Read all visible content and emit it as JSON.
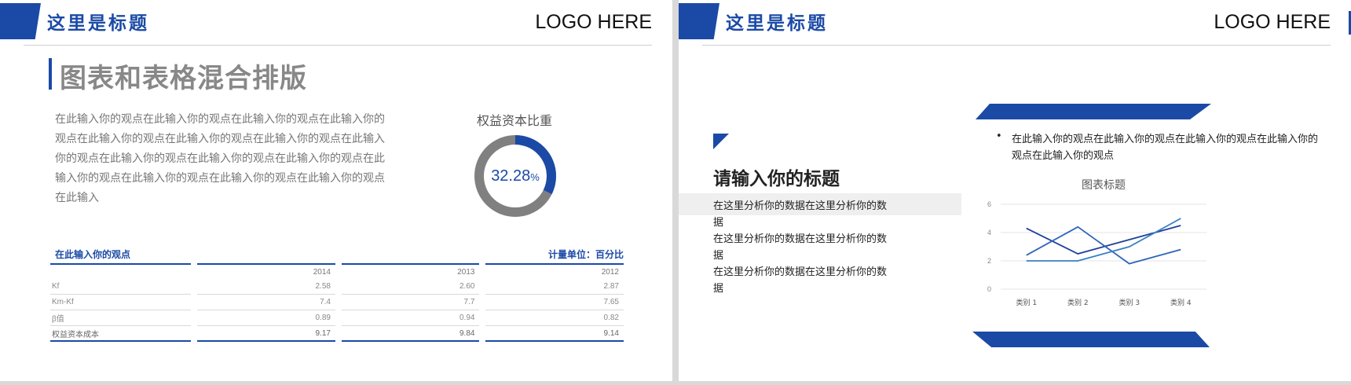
{
  "left": {
    "header_title": "这里是标题",
    "logo": "LOGO HERE",
    "section_title": "图表和表格混合排版",
    "paragraph": "在此输入你的观点在此输入你的观点在此输入你的观点在此输入你的观点在此输入你的观点在此输入你的观点在此输入你的观点在此输入你的观点在此输入你的观点在此输入你的观点在此输入你的观点在此输入你的观点在此输入你的观点在此输入你的观点在此输入你的观点在此输入",
    "donut": {
      "title": "权益资本比重",
      "value": "32.28",
      "unit": "%",
      "fraction": 0.3228,
      "color": "#1b4aa6",
      "track": "#808080"
    },
    "table": {
      "caption": "在此输入你的观点",
      "unit": "计量单位：百分比",
      "columns": [
        "",
        "2014",
        "2013",
        "2012"
      ],
      "rows": [
        [
          "Kf",
          "2.58",
          "2.60",
          "2.87"
        ],
        [
          "Km-Kf",
          "7.4",
          "7.7",
          "7.65"
        ],
        [
          "β值",
          "0.89",
          "0.94",
          "0.82"
        ],
        [
          "权益资本成本",
          "9.17",
          "9.84",
          "9.14"
        ]
      ]
    }
  },
  "right": {
    "header_title": "这里是标题",
    "logo": "LOGO HERE",
    "title": "请输入你的标题",
    "lines": [
      "在这里分析你的数据在这里分析你的数据",
      "在这里分析你的数据在这里分析你的数据"
    ],
    "bullet_mark": "•",
    "bullet_text": "在此输入你的观点在此输入你的观点在此输入你的观点在此输入你的观点在此输入你的观点",
    "accent_color": "#1b4aa6"
  },
  "chart_data": {
    "type": "line",
    "title": "图表标题",
    "categories": [
      "类别 1",
      "类别 2",
      "类别 3",
      "类别 4"
    ],
    "ylim": [
      0,
      6
    ],
    "yticks": [
      0,
      2,
      4,
      6
    ],
    "grid": true,
    "series": [
      {
        "values": [
          4.3,
          2.5,
          3.5,
          4.5
        ],
        "color": "#1f3f9a"
      },
      {
        "values": [
          2.4,
          4.4,
          1.8,
          2.8
        ],
        "color": "#2e65b8"
      },
      {
        "values": [
          2.0,
          2.0,
          3.0,
          5.0
        ],
        "color": "#3a7fc4"
      }
    ]
  }
}
